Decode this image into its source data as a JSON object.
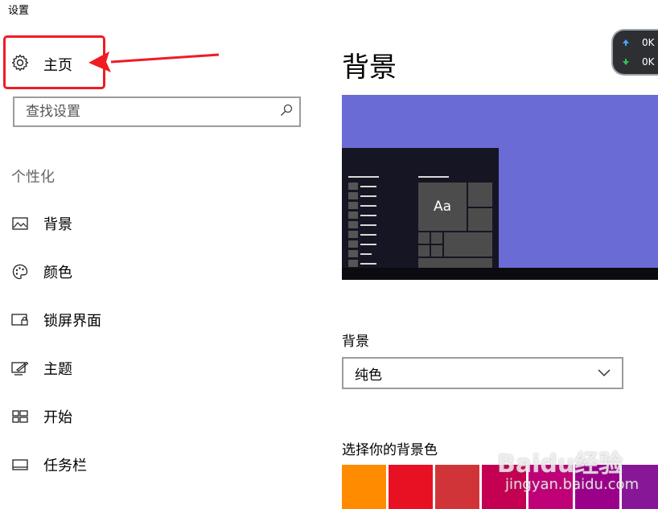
{
  "window": {
    "title": "设置"
  },
  "sidebar": {
    "home_label": "主页",
    "search_placeholder": "查找设置",
    "section_title": "个性化",
    "items": [
      {
        "label": "背景",
        "icon": "picture-icon"
      },
      {
        "label": "颜色",
        "icon": "palette-icon"
      },
      {
        "label": "锁屏界面",
        "icon": "lock-screen-icon"
      },
      {
        "label": "主题",
        "icon": "theme-icon"
      },
      {
        "label": "开始",
        "icon": "start-icon"
      },
      {
        "label": "任务栏",
        "icon": "taskbar-icon"
      }
    ]
  },
  "main": {
    "title": "背景",
    "preview": {
      "sample_text": "Aa",
      "background_color": "#6b6bd6"
    },
    "background_select": {
      "label": "背景",
      "value": "纯色"
    },
    "color_picker": {
      "label": "选择你的背景色",
      "swatches": [
        "#ff8c00",
        "#e81123",
        "#d13438",
        "#c30052",
        "#bf0077",
        "#9a0089",
        "#881798"
      ]
    }
  },
  "network_widget": {
    "up": "0K",
    "down": "0K"
  },
  "watermark": {
    "brand": "Baidu经验",
    "url": "jingyan.baidu.com"
  },
  "colors": {
    "annotation_red": "#ee1c24",
    "accent": "#6b6bd6"
  }
}
